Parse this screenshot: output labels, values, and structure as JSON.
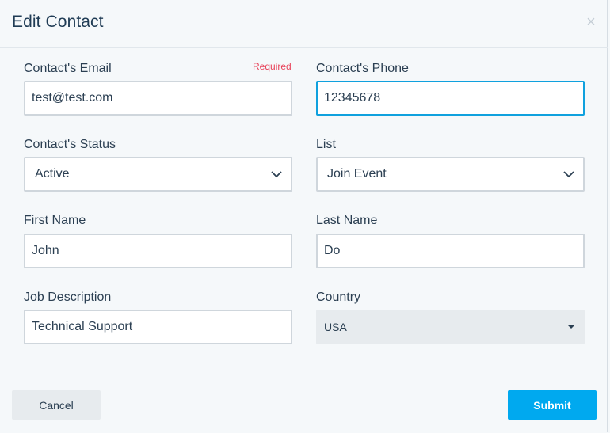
{
  "modal": {
    "title": "Edit Contact",
    "close_symbol": "×"
  },
  "fields": {
    "email": {
      "label": "Contact's Email",
      "required": "Required",
      "value": "test@test.com"
    },
    "phone": {
      "label": "Contact's Phone",
      "value": "12345678"
    },
    "status": {
      "label": "Contact's Status",
      "value": "Active"
    },
    "list": {
      "label": "List",
      "value": "Join Event"
    },
    "first_name": {
      "label": "First Name",
      "value": "John"
    },
    "last_name": {
      "label": "Last Name",
      "value": "Do"
    },
    "job": {
      "label": "Job Description",
      "value": "Technical Support"
    },
    "country": {
      "label": "Country",
      "value": "USA"
    }
  },
  "footer": {
    "cancel_label": "Cancel",
    "submit_label": "Submit"
  },
  "colors": {
    "accent": "#00a9ef",
    "focus_border": "#10a1de",
    "required": "#e8435a"
  },
  "icons": {
    "select_chevron": "chevron-down-icon",
    "country_caret": "caret-down-icon",
    "close": "close-icon"
  }
}
